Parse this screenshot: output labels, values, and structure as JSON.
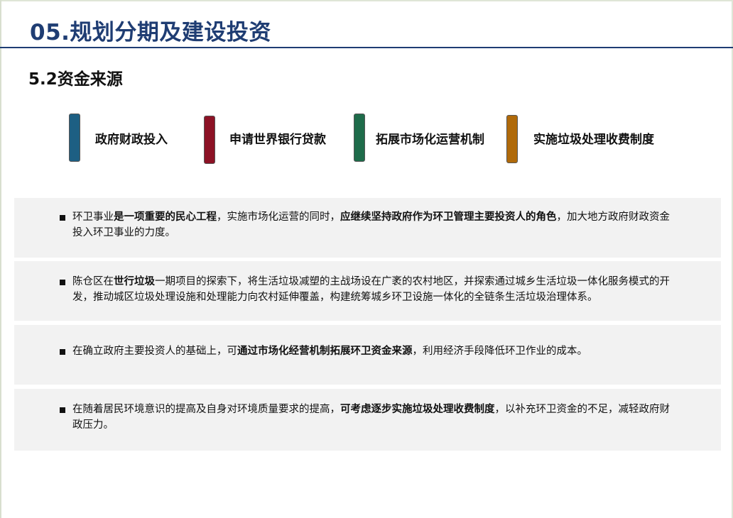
{
  "header": {
    "title": "05.规划分期及建设投资",
    "subtitle": "5.2资金来源"
  },
  "sources": [
    {
      "label": "政府财政投入",
      "color": "#1d5f83"
    },
    {
      "label": "申请世界银行贷款",
      "color": "#8c1225"
    },
    {
      "label": "拓展市场化运营机制",
      "color": "#1e6b4a"
    },
    {
      "label": "实施垃圾处理收费制度",
      "color": "#b06a0a"
    }
  ],
  "paragraphs": [
    {
      "parts": [
        {
          "text": "环卫事业",
          "bold": false
        },
        {
          "text": "是一项重要的民心工程",
          "bold": true
        },
        {
          "text": "，实施市场化运营的同时，",
          "bold": false
        },
        {
          "text": "应继续坚持政府作为环卫管理主要投资人的角色",
          "bold": true
        },
        {
          "text": "，加大地方政府财政资金投入环卫事业的力度。",
          "bold": false
        }
      ]
    },
    {
      "parts": [
        {
          "text": "陈仓区在",
          "bold": false
        },
        {
          "text": "世行垃圾",
          "bold": true
        },
        {
          "text": "一期项目的探索下，将生活垃圾减塑的主战场设在广袤的农村地区，并探索通过城乡生活垃圾一体化服务模式的开发，推动城区垃圾处理设施和处理能力向农村延伸覆盖，构建统筹城乡环卫设施一体化的全链条生活垃圾治理体系。",
          "bold": false
        }
      ]
    },
    {
      "parts": [
        {
          "text": "在确立政府主要投资人的基础上，可",
          "bold": false
        },
        {
          "text": "通过市场化经营机制拓展环卫资金来源",
          "bold": true
        },
        {
          "text": "，利用经济手段降低环卫作业的成本。",
          "bold": false
        }
      ]
    },
    {
      "parts": [
        {
          "text": "在随着居民环境意识的提高及自身对环境质量要求的提高，",
          "bold": false
        },
        {
          "text": "可考虑逐步实施垃圾处理收费制度",
          "bold": true
        },
        {
          "text": "，以补充环卫资金的不足，减轻政府财政压力。",
          "bold": false
        }
      ]
    }
  ]
}
